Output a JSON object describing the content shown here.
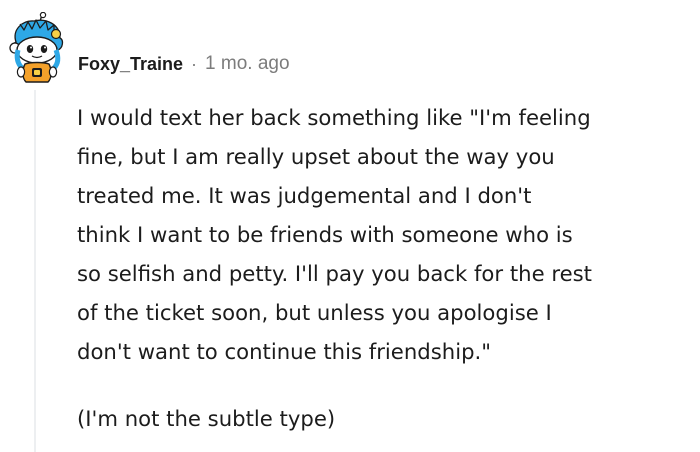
{
  "comment": {
    "author": "Foxy_Traine",
    "separator": "·",
    "timestamp": "1 mo. ago",
    "avatar_icon": "snoo-avatar-icon",
    "paragraphs": [
      {
        "lines": [
          "I would text her back something like \"I'm feeling",
          "fine, but I am really upset about the way you",
          "treated me. It was judgemental and I don't",
          "think I want to be friends with someone who is",
          "so selfish and petty. I'll pay you back for the rest",
          "of the ticket soon, but unless you apologise I",
          "don't want to continue this friendship.\""
        ]
      },
      {
        "lines": [
          "(I'm not the subtle type)"
        ]
      }
    ]
  },
  "colors": {
    "text": "#1c1c1c",
    "meta_text": "#7c7c7c",
    "thread_line": "#edeff1",
    "avatar_body": "#ffffff",
    "avatar_hair": "#2ea8e6",
    "avatar_shirt": "#f4a12a"
  }
}
